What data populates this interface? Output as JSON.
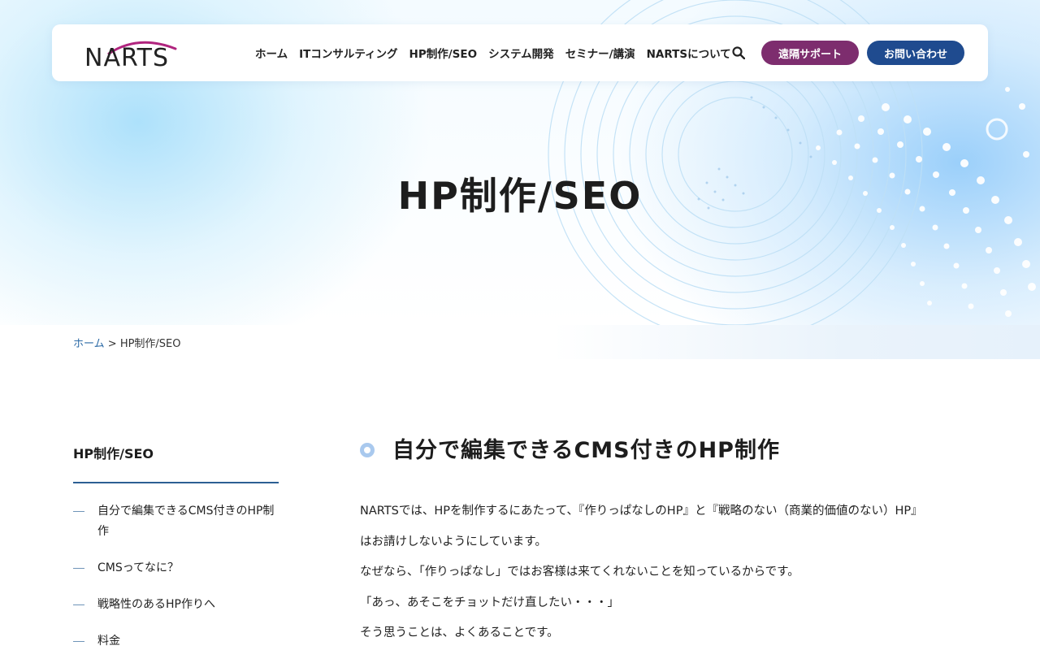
{
  "header": {
    "logo": "NARTS",
    "nav": [
      "ホーム",
      "ITコンサルティング",
      "HP制作/SEO",
      "システム開発",
      "セミナー/講演",
      "NARTSについて"
    ],
    "search_icon": "search-icon",
    "remote_support_label": "遠隔サポート",
    "contact_label": "お問い合わせ"
  },
  "colors": {
    "remote_button": "#7d2d6e",
    "contact_button": "#1f4b8f",
    "logo_accent": "#b0247e",
    "link": "#2c6aa6"
  },
  "hero": {
    "title": "HP制作/SEO"
  },
  "breadcrumb": {
    "home": "ホーム",
    "separator": ">",
    "current": "HP制作/SEO"
  },
  "sidebar": {
    "title": "HP制作/SEO",
    "items": [
      "自分で編集できるCMS付きのHP制作",
      "CMSってなに？",
      "戦略性のあるHP作りへ",
      "料金"
    ]
  },
  "main": {
    "section_title": "自分で編集できるCMS付きのHP制作",
    "paragraphs": [
      "NARTSでは、HPを制作するにあたって、『作りっぱなしのHP』と『戦略のない（商業的価値のない）HP』",
      "はお請けしないようにしています。",
      "なぜなら、「作りっぱなし」ではお客様は来てくれないことを知っているからです。",
      "「あっ、あそこをチョットだけ直したい・・・」",
      "そう思うことは、よくあることです。"
    ]
  }
}
